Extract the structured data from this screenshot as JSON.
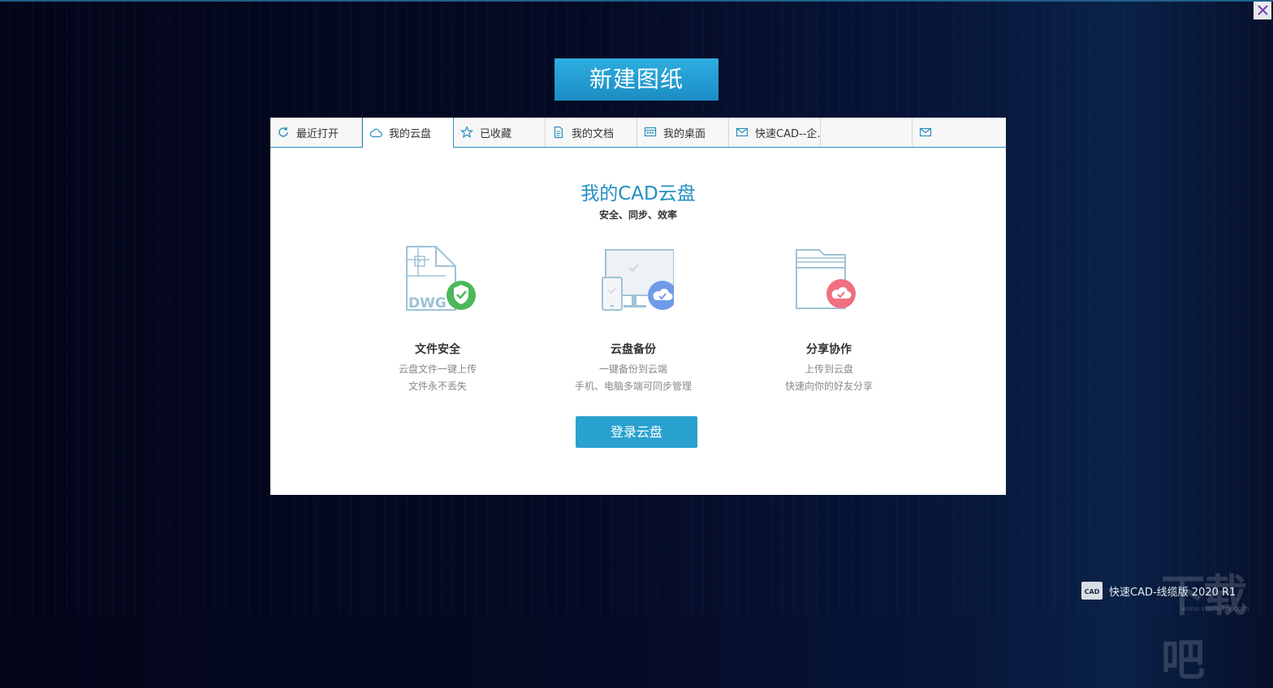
{
  "new_drawing_label": "新建图纸",
  "tabs": [
    {
      "label": "最近打开",
      "icon": "refresh-icon"
    },
    {
      "label": "我的云盘",
      "icon": "cloud-icon",
      "active": true
    },
    {
      "label": "已收藏",
      "icon": "star-icon"
    },
    {
      "label": "我的文档",
      "icon": "document-icon"
    },
    {
      "label": "我的桌面",
      "icon": "desktop-icon"
    },
    {
      "label": "快速CAD--企...",
      "icon": "mail-icon"
    },
    {
      "label": "",
      "icon": ""
    },
    {
      "label": "",
      "icon": "mail-icon"
    }
  ],
  "cloud": {
    "title": "我的CAD云盘",
    "subtitle": "安全、同步、效率",
    "features": [
      {
        "title": "文件安全",
        "line1": "云盘文件一键上传",
        "line2": "文件永不丢失",
        "art_text": "DWG"
      },
      {
        "title": "云盘备份",
        "line1": "一键备份到云端",
        "line2": "手机、电脑多端可同步管理"
      },
      {
        "title": "分享协作",
        "line1": "上传到云盘",
        "line2": "快速向你的好友分享"
      }
    ],
    "login_label": "登录云盘"
  },
  "brand": {
    "text": "快速CAD-线缆版 2020 R1",
    "logo_text": "CAD"
  },
  "watermark": {
    "text": "下载吧",
    "sub": "www.xiazaiba.com"
  },
  "colors": {
    "accent": "#2aa2cf",
    "title_blue": "#1f8ec2",
    "shield_green": "#4cb85a",
    "cloud_blue": "#6f9be8",
    "cloud_red": "#ef6f7f"
  }
}
